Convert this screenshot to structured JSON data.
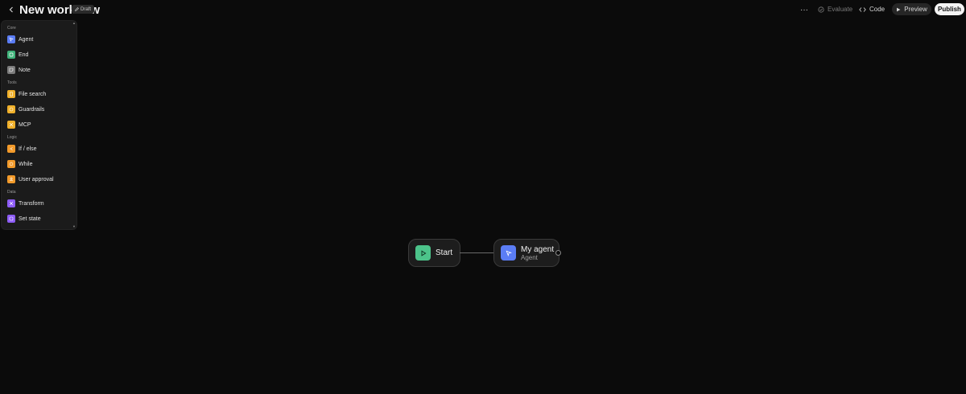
{
  "header": {
    "title": "New workflow",
    "draft_label": "Draft",
    "more_label": "···",
    "evaluate_label": "Evaluate",
    "code_label": "Code",
    "preview_label": "Preview",
    "publish_label": "Publish"
  },
  "panel": {
    "sections": {
      "core": "Core",
      "tools": "Tools",
      "logic": "Logic",
      "data": "Data"
    },
    "items": [
      {
        "label": "Agent",
        "icon": "agent-icon",
        "color": "#5b7df5"
      },
      {
        "label": "End",
        "icon": "end-icon",
        "color": "#3fb37a"
      },
      {
        "label": "Note",
        "icon": "note-icon",
        "color": "#7c7c7c"
      },
      {
        "label": "File search",
        "icon": "file-search-icon",
        "color": "#f0b02a"
      },
      {
        "label": "Guardrails",
        "icon": "guardrails-icon",
        "color": "#f0b02a"
      },
      {
        "label": "MCP",
        "icon": "mcp-icon",
        "color": "#f0b02a"
      },
      {
        "label": "If / else",
        "icon": "branch-icon",
        "color": "#f29a2a"
      },
      {
        "label": "While",
        "icon": "loop-icon",
        "color": "#f29a2a"
      },
      {
        "label": "User approval",
        "icon": "approval-icon",
        "color": "#f29a2a"
      },
      {
        "label": "Transform",
        "icon": "transform-icon",
        "color": "#8d5cf6"
      },
      {
        "label": "Set state",
        "icon": "state-icon",
        "color": "#8d5cf6"
      }
    ]
  },
  "canvas": {
    "start": {
      "title": "Start",
      "color": "#4cc38a"
    },
    "agent": {
      "title": "My agent",
      "subtitle": "Agent",
      "color": "#5b7df5"
    }
  }
}
